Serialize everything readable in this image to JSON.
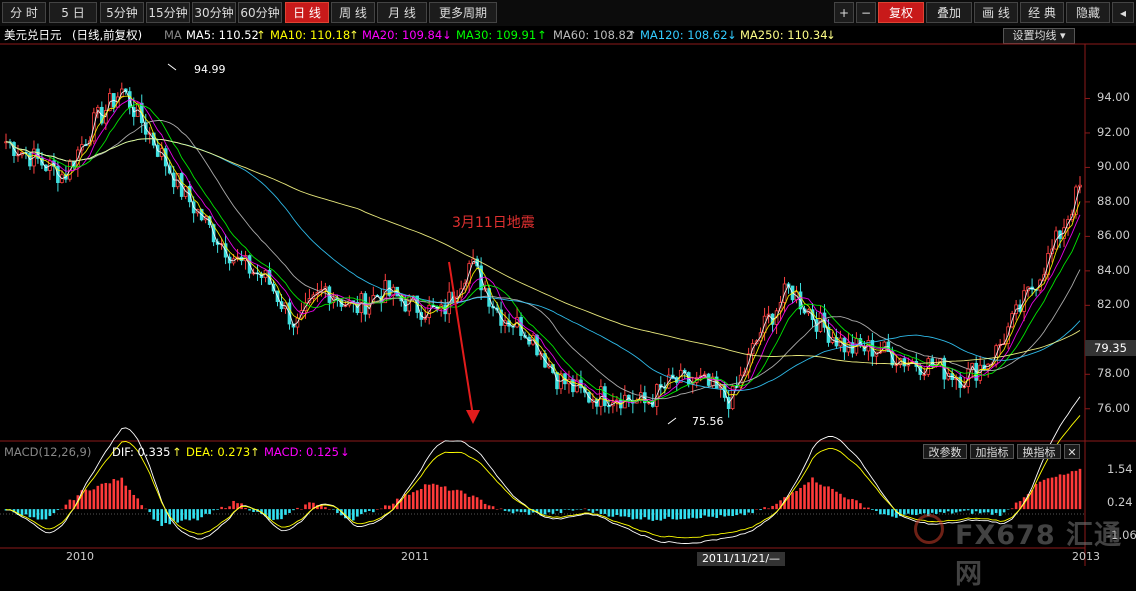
{
  "toolbar": {
    "periods": [
      "分 时",
      "5 日",
      "5分钟",
      "15分钟",
      "30分钟",
      "60分钟",
      "日 线",
      "周 线",
      "月 线",
      "更多周期"
    ],
    "active_period": "日 线",
    "right_buttons": [
      "+",
      "−",
      "复权",
      "叠加",
      "画 线",
      "经 典",
      "隐藏"
    ],
    "active_right": "复权"
  },
  "info_bar": {
    "instrument": "美元兑日元",
    "mode": "(日线,前复权)",
    "ma_tag": "MA",
    "ma": [
      {
        "label": "MA5: 110.52",
        "arrow": "↑",
        "color": "#ffffff"
      },
      {
        "label": "MA10: 110.18",
        "arrow": "↑",
        "color": "#ffff00"
      },
      {
        "label": "MA20: 109.84",
        "arrow": "↓",
        "color": "#ff00ff"
      },
      {
        "label": "MA30: 109.91",
        "arrow": "↑",
        "color": "#00ff00"
      },
      {
        "label": "MA60: 108.82",
        "arrow": "↑",
        "color": "#bbbbbb"
      },
      {
        "label": "MA120: 108.62",
        "arrow": "↓",
        "color": "#33ccff"
      },
      {
        "label": "MA250: 110.34",
        "arrow": "↓",
        "color": "#ffff88"
      }
    ],
    "settings_label": "设置均线"
  },
  "annotations": {
    "quake": "3月11日地震",
    "high": "94.99",
    "low": "75.56",
    "last_price": "79.35"
  },
  "macd_header": {
    "title": "MACD(12,26,9)",
    "dif": "DIF: 0.335",
    "dif_arrow": "↑",
    "dea": "DEA: 0.273",
    "dea_arrow": "↑",
    "macd": "MACD: 0.125",
    "macd_arrow": "↓",
    "buttons": [
      "改参数",
      "加指标",
      "换指标",
      "✕"
    ]
  },
  "x_labels": [
    "2010",
    "2011",
    "2013"
  ],
  "date_tag": "2011/11/21/—",
  "watermark": "FX678 汇通网",
  "chart_data": {
    "type": "line",
    "title": "美元兑日元 (日线,前复权)",
    "price_ticks": [
      94.0,
      92.0,
      90.0,
      88.0,
      86.0,
      84.0,
      82.0,
      78.0,
      76.0
    ],
    "price_range": [
      75.0,
      96.0
    ],
    "macd_ticks": [
      1.54,
      0.24,
      -1.06
    ],
    "macd_range": [
      -1.4,
      1.8
    ],
    "x_labels": [
      "2010",
      "2011",
      "2013"
    ],
    "close_series": {
      "name": "USD/JPY",
      "x": [
        "2009-12",
        "2010-01",
        "2010-02",
        "2010-03",
        "2010-04",
        "2010-05",
        "2010-06",
        "2010-07",
        "2010-08",
        "2010-09",
        "2010-10",
        "2010-11",
        "2010-12",
        "2011-01",
        "2011-02",
        "2011-03",
        "2011-04",
        "2011-05",
        "2011-06",
        "2011-07",
        "2011-08",
        "2011-09",
        "2011-10",
        "2011-11",
        "2011-12",
        "2012-01",
        "2012-02",
        "2012-03",
        "2012-04",
        "2012-05",
        "2012-06",
        "2012-07",
        "2012-08",
        "2012-09",
        "2012-10",
        "2012-11",
        "2012-12",
        "2013-01"
      ],
      "values": [
        91.5,
        90.5,
        89.5,
        92.5,
        94.5,
        91.8,
        88.8,
        86.5,
        84.5,
        83.5,
        80.8,
        83.0,
        81.8,
        82.8,
        82.0,
        81.5,
        84.5,
        81.5,
        80.5,
        77.8,
        76.7,
        76.8,
        76.3,
        77.6,
        77.5,
        76.5,
        80.5,
        83.0,
        81.0,
        79.5,
        79.5,
        78.8,
        78.5,
        77.8,
        79.0,
        82.0,
        85.0,
        88.8
      ]
    },
    "macd_series": {
      "name": "MACD",
      "values_sample": [
        0.0,
        -0.5,
        0.7,
        1.2,
        -0.6,
        -0.4,
        0.3,
        -0.5,
        0.3,
        -0.4,
        0.2,
        1.0,
        0.6,
        -0.1,
        -0.2,
        0.0,
        -0.3,
        -0.4,
        -0.3,
        -0.3,
        0.1,
        1.2,
        0.4,
        -0.3,
        -0.2,
        -0.1,
        -0.2,
        1.1,
        1.5
      ]
    },
    "grid": false,
    "legend": "top-left"
  }
}
